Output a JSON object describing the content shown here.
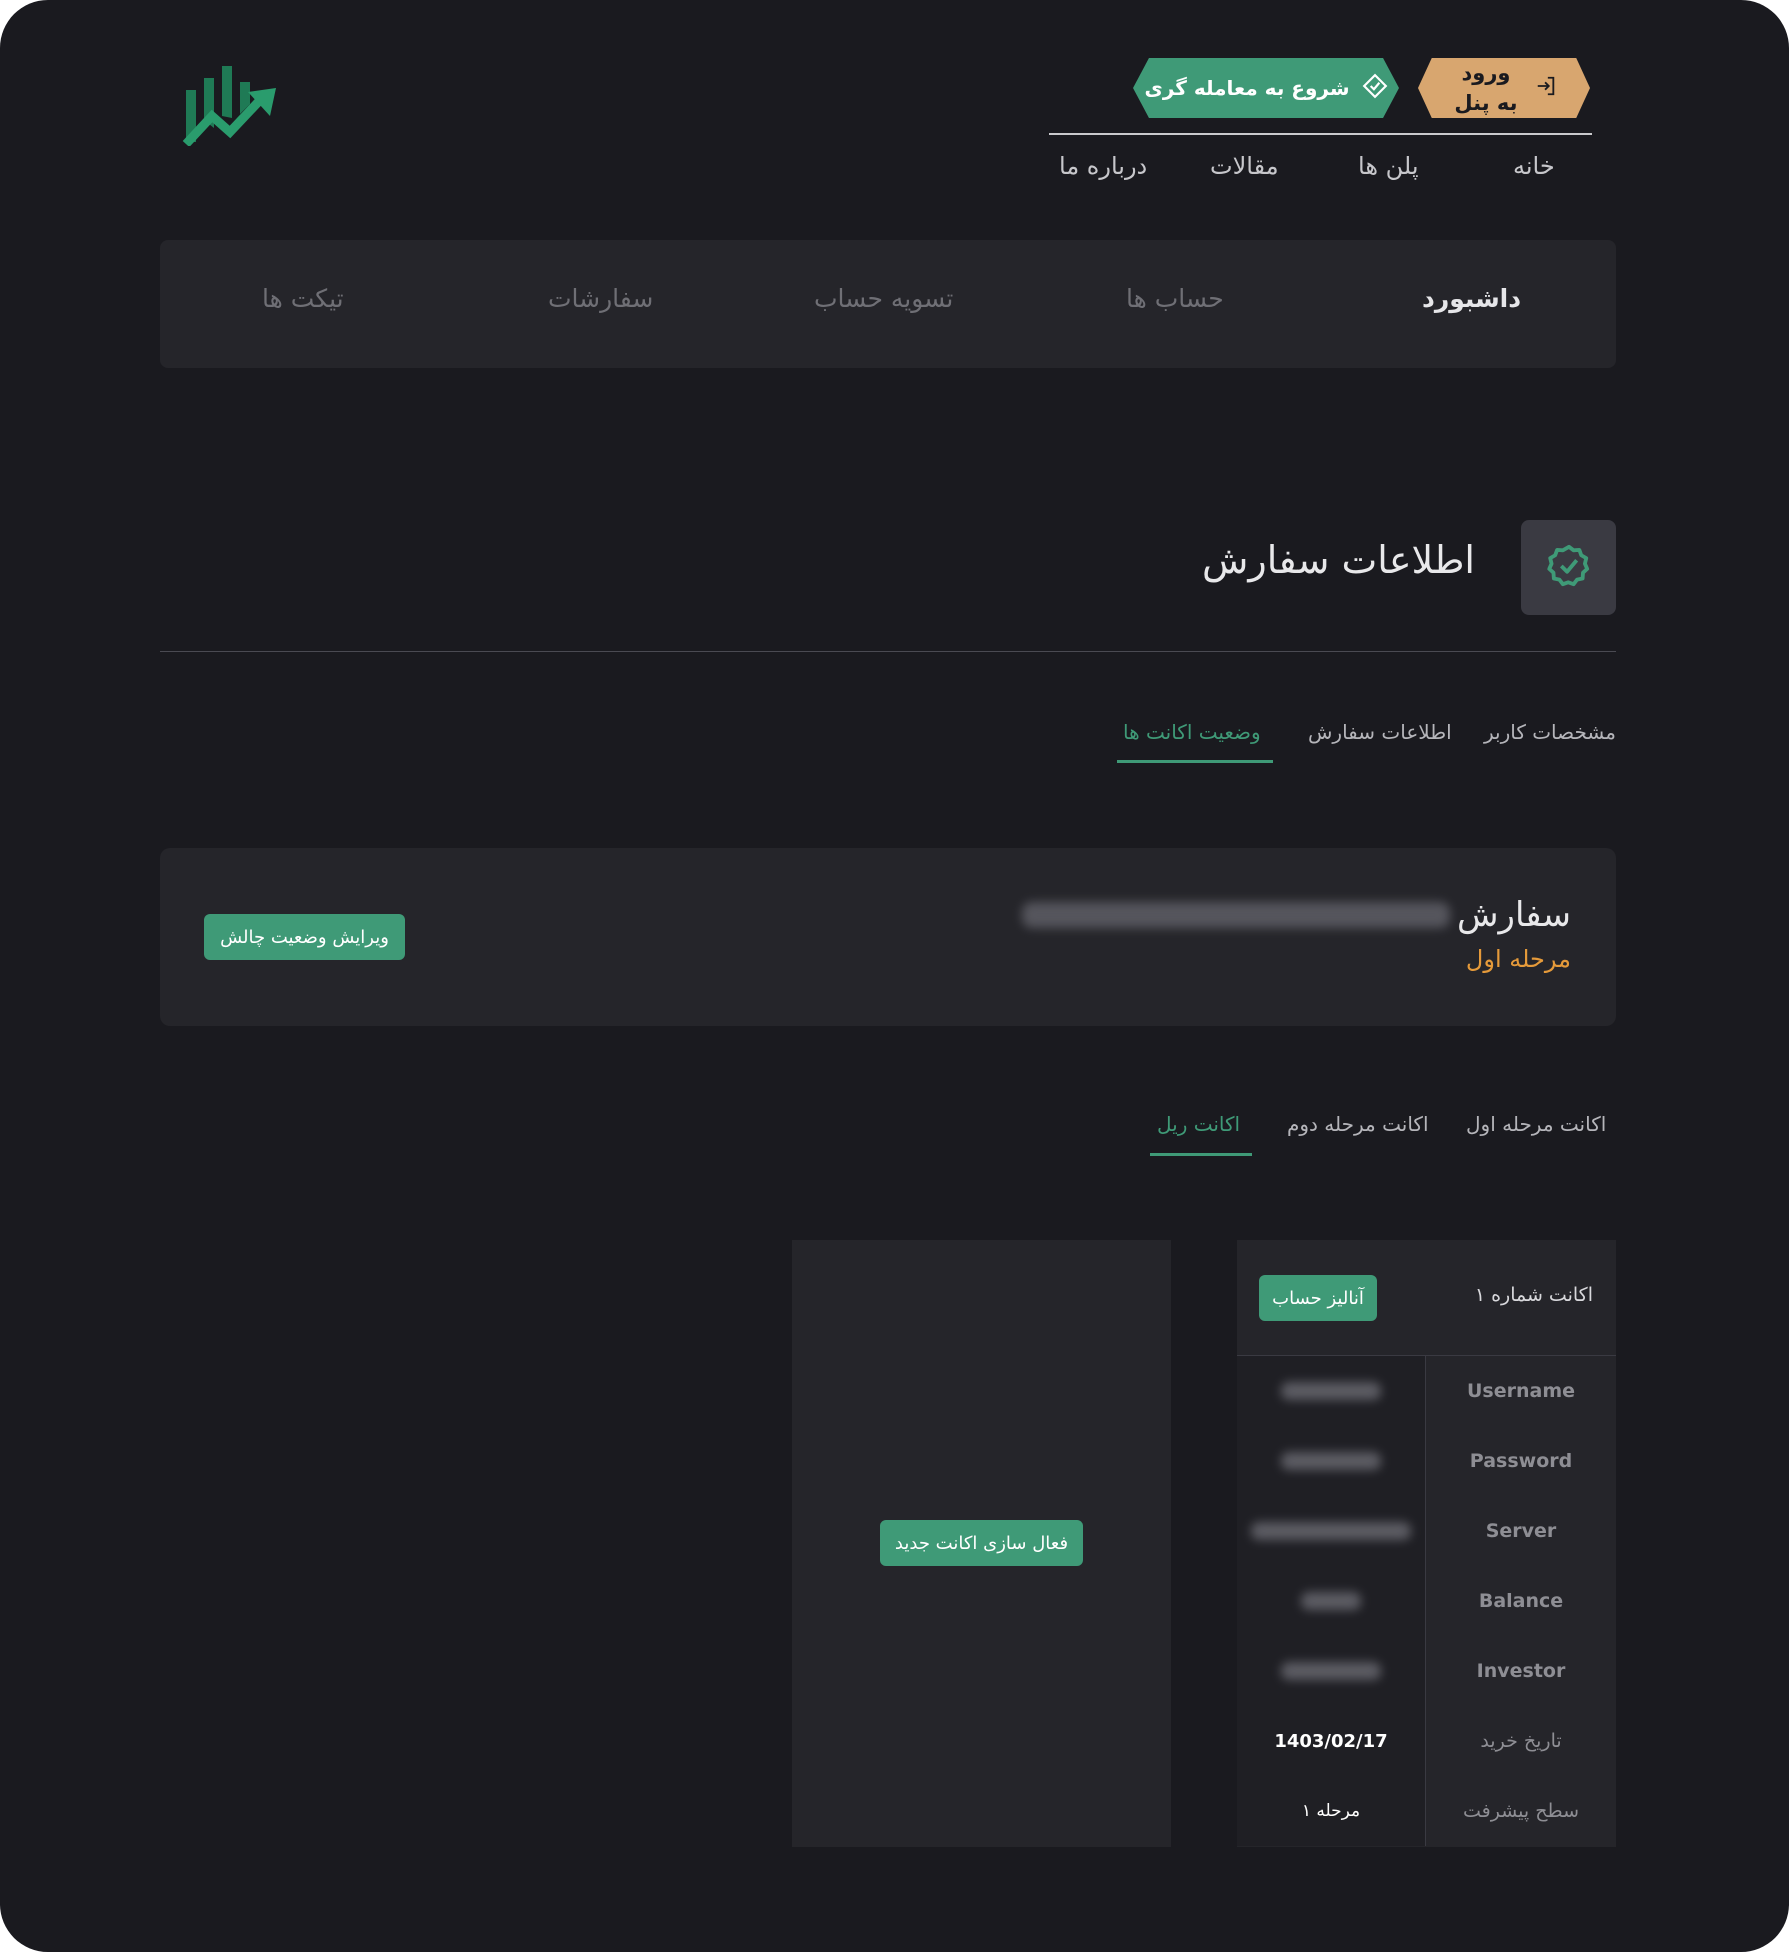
{
  "colors": {
    "background": "#1a1a1f",
    "panel": "#25252a",
    "accent_green": "#3f9a77",
    "accent_orange": "#d8a66f",
    "stage_orange": "#e59a3a"
  },
  "header": {
    "login_label": "ورود به پنل",
    "trade_label": "شروع به معامله گری",
    "nav": [
      "خانه",
      "پلن ها",
      "مقالات",
      "درباره ما"
    ]
  },
  "dashboard_nav": [
    "داشبورد",
    "حساب ها",
    "تسویه حساب",
    "سفارشات",
    "تیکت ها"
  ],
  "page": {
    "title": "اطلاعات سفارش"
  },
  "tabs": [
    "مشخصات کاربر",
    "اطلاعات سفارش",
    "وضعیت اکانت ها"
  ],
  "order": {
    "title": "سفارش",
    "stage": "مرحله اول",
    "edit_button": "ویرایش وضعیت چالش"
  },
  "account_tabs": [
    "اکانت مرحله اول",
    "اکانت مرحله دوم",
    "اکانت  ریل"
  ],
  "account": {
    "title": "اکانت شماره ۱",
    "analyze_button": "آنالیز حساب",
    "rows": [
      {
        "label": "Username"
      },
      {
        "label": "Password"
      },
      {
        "label": "Server"
      },
      {
        "label": "Balance"
      },
      {
        "label": "Investor"
      },
      {
        "label": "تاریخ خرید",
        "value": "1403/02/17"
      },
      {
        "label": "سطح پیشرفت",
        "value": "مرحله ۱"
      }
    ]
  },
  "new_account_button": "فعال سازی اکانت جدید"
}
